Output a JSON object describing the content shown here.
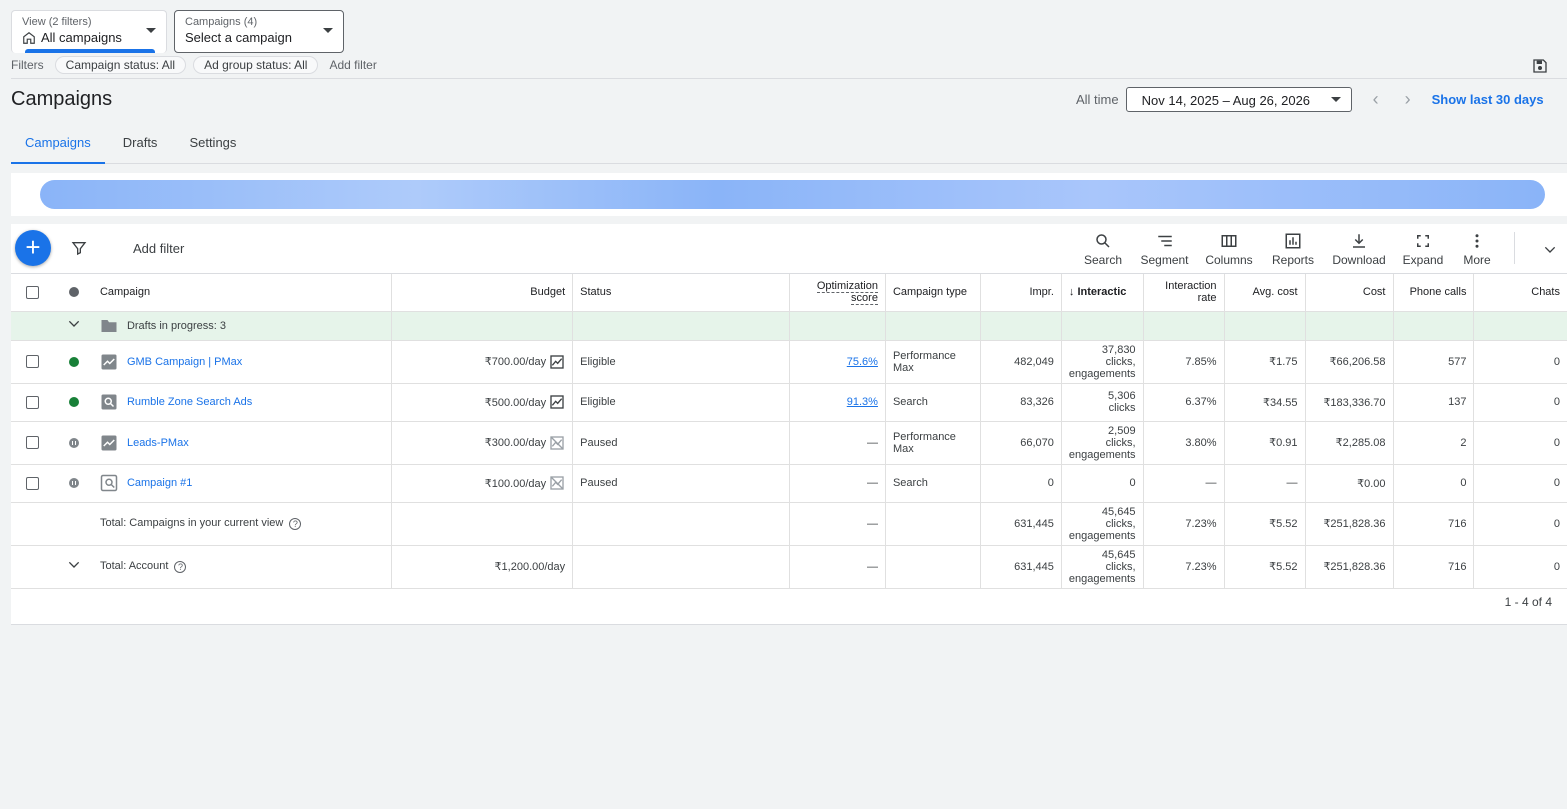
{
  "view_selector": {
    "label": "View (2 filters)",
    "value": "All campaigns"
  },
  "campaign_selector": {
    "label": "Campaigns (4)",
    "value": "Select a campaign"
  },
  "filters": {
    "label": "Filters",
    "chips": [
      "Campaign status: All",
      "Ad group status: All"
    ],
    "add_filter": "Add filter"
  },
  "page_title": "Campaigns",
  "date_range": {
    "label": "All time",
    "value": "Nov 14, 2025 – Aug 26, 2026",
    "show_last": "Show last 30 days"
  },
  "tabs": [
    "Campaigns",
    "Drafts",
    "Settings"
  ],
  "toolbar": {
    "add_filter": "Add filter",
    "tools": [
      "Search",
      "Segment",
      "Columns",
      "Reports",
      "Download",
      "Expand",
      "More"
    ]
  },
  "table": {
    "headers": {
      "campaign": "Campaign",
      "budget": "Budget",
      "status": "Status",
      "opt_score_1": "Optimization",
      "opt_score_2": "score",
      "campaign_type": "Campaign type",
      "impr": "Impr.",
      "interactions": "Interactic",
      "interaction_rate_1": "Interaction",
      "interaction_rate_2": "rate",
      "avg_cost": "Avg. cost",
      "cost": "Cost",
      "phone_calls": "Phone calls",
      "chats": "Chats"
    },
    "drafts_row": "Drafts in progress: 3",
    "rows": [
      {
        "name": "GMB Campaign | PMax",
        "budget": "₹700.00/day",
        "status": "Eligible",
        "opt": "75.6%",
        "type_1": "Performance",
        "type_2": "Max",
        "impr": "482,049",
        "int_1": "37,830",
        "int_2": "clicks,",
        "int_3": "engagements",
        "rate": "7.85%",
        "avg": "₹1.75",
        "cost": "₹66,206.58",
        "calls": "577",
        "chats": "0"
      },
      {
        "name": "Rumble Zone Search Ads",
        "budget": "₹500.00/day",
        "status": "Eligible",
        "opt": "91.3%",
        "type_1": "Search",
        "type_2": "",
        "impr": "83,326",
        "int_1": "5,306",
        "int_2": "clicks",
        "int_3": "",
        "rate": "6.37%",
        "avg": "₹34.55",
        "cost": "₹183,336.70",
        "calls": "137",
        "chats": "0"
      },
      {
        "name": "Leads-PMax",
        "budget": "₹300.00/day",
        "status": "Paused",
        "opt": "—",
        "type_1": "Performance",
        "type_2": "Max",
        "impr": "66,070",
        "int_1": "2,509",
        "int_2": "clicks,",
        "int_3": "engagements",
        "rate": "3.80%",
        "avg": "₹0.91",
        "cost": "₹2,285.08",
        "calls": "2",
        "chats": "0"
      },
      {
        "name": "Campaign #1",
        "budget": "₹100.00/day",
        "status": "Paused",
        "opt": "—",
        "type_1": "Search",
        "type_2": "",
        "impr": "0",
        "int_1": "0",
        "int_2": "",
        "int_3": "",
        "rate": "—",
        "avg": "—",
        "cost": "₹0.00",
        "calls": "0",
        "chats": "0"
      }
    ],
    "total_view": {
      "label": "Total: Campaigns in your current view",
      "opt": "—",
      "impr": "631,445",
      "int_1": "45,645",
      "int_2": "clicks,",
      "int_3": "engagements",
      "rate": "7.23%",
      "avg": "₹5.52",
      "cost": "₹251,828.36",
      "calls": "716",
      "chats": "0"
    },
    "total_account": {
      "label": "Total: Account",
      "budget": "₹1,200.00/day",
      "opt": "—",
      "impr": "631,445",
      "int_1": "45,645",
      "int_2": "clicks,",
      "int_3": "engagements",
      "rate": "7.23%",
      "avg": "₹5.52",
      "cost": "₹251,828.36",
      "calls": "716",
      "chats": "0"
    }
  },
  "pagination": "1 - 4 of 4"
}
